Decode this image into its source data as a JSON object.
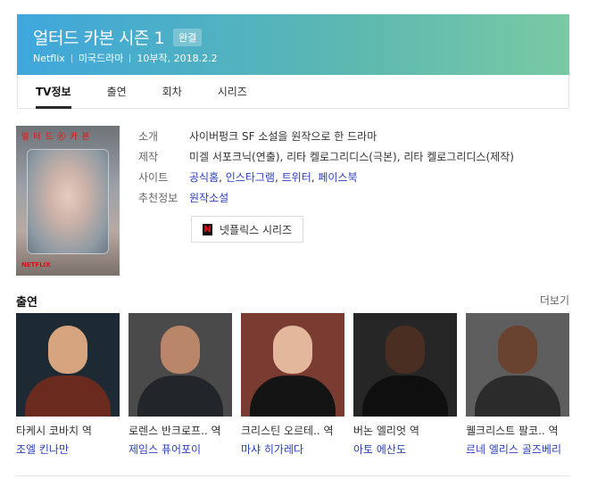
{
  "header": {
    "title": "얼터드 카본 시즌 1",
    "badge": "완결",
    "channel": "Netflix",
    "genre": "미국드라마",
    "episodes_date": "10부작, 2018.2.2"
  },
  "tabs": [
    {
      "label": "TV정보"
    },
    {
      "label": "출연"
    },
    {
      "label": "회차"
    },
    {
      "label": "시리즈"
    }
  ],
  "poster": {
    "title_text": "얼 터 드 Ⓚ 카 본",
    "brand": "NETFLIX"
  },
  "info": {
    "intro_label": "소개",
    "intro_value": "사이버펑크 SF 소설을 원작으로 한 드라마",
    "staff_label": "제작",
    "staff_value": "미겔 서포크닉(연출), 리타 켈로그리디스(극본), 리타 켈로그리디스(제작)",
    "site_label": "사이트",
    "sites": [
      "공식홈",
      "인스타그램",
      "트위터",
      "페이스북"
    ],
    "recommend_label": "추천정보",
    "recommend_value": "원작소설"
  },
  "netflix_button": {
    "logo": "N",
    "label": "넷플릭스 시리즈"
  },
  "cast": {
    "title": "출연",
    "more": "더보기",
    "members": [
      {
        "role": "타케시 코바치 역",
        "actor": "조엘 킨나만"
      },
      {
        "role": "로렌스 반크로프.. 역",
        "actor": "제임스 퓨어포이"
      },
      {
        "role": "크리스틴 오르테.. 역",
        "actor": "마샤 히가레다"
      },
      {
        "role": "버논 엘리엇 역",
        "actor": "아토 에산도"
      },
      {
        "role": "퀠크리스트 팔코.. 역",
        "actor": "르네 엘리스 골즈베리"
      }
    ]
  },
  "colors": {
    "header_start": "#3fa7dc",
    "header_end": "#79c9a4",
    "link": "#2a3fbc",
    "netflix_red": "#e50914"
  }
}
